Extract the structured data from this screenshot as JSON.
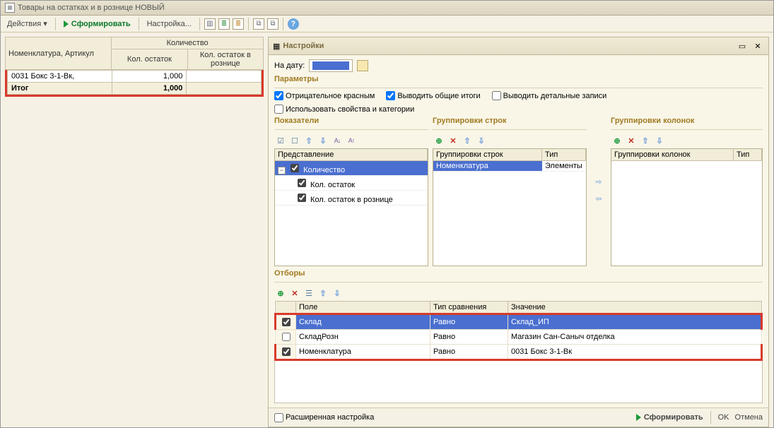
{
  "window": {
    "title": "Товары на остатках и в рознице НОВЫЙ"
  },
  "toolbar": {
    "actions_label": "Действия",
    "run_label": "Сформировать",
    "settings_label": "Настройка..."
  },
  "report": {
    "col_nom": "Номенклатура, Артикул",
    "col_qty": "Количество",
    "col_rest": "Кол. остаток",
    "col_rest_retail": "Кол. остаток в рознице",
    "rows": [
      {
        "nom": "0031 Бокс 3-1-Вк,",
        "rest": "1,000",
        "retail": ""
      }
    ],
    "total_label": "Итог",
    "total_rest": "1,000"
  },
  "settings": {
    "title": "Настройки",
    "date_label": "На дату:",
    "date_value": "  .  .  ",
    "section_params": "Параметры",
    "chk_neg": "Отрицательное красным",
    "chk_grand": "Выводить общие итоги",
    "chk_detail": "Выводить детальные записи",
    "chk_props": "Использовать свойства и категории",
    "section_indicators": "Показатели",
    "ind_col": "Представление",
    "ind_root": "Количество",
    "ind_items": [
      "Кол. остаток",
      "Кол. остаток в рознице"
    ],
    "section_grp_rows": "Группировки строк",
    "grp_col1": "Группировки строк",
    "grp_col2": "Тип",
    "grp_rows": [
      {
        "name": "Номенклатура",
        "type": "Элементы"
      }
    ],
    "section_grp_cols": "Группировки колонок",
    "gcol_col1": "Группировки колонок",
    "gcol_col2": "Тип",
    "section_filters": "Отборы",
    "filt_field": "Поле",
    "filt_cmp": "Тип сравнения",
    "filt_val": "Значение",
    "filters": [
      {
        "on": true,
        "field": "Склад",
        "cmp": "Равно",
        "val": "Склад_ИП",
        "sel": true,
        "red": 1
      },
      {
        "on": false,
        "field": "СкладРозн",
        "cmp": "Равно",
        "val": "Магазин Сан-Саныч отделка",
        "sel": false,
        "red": 0
      },
      {
        "on": true,
        "field": "Номенклатура",
        "cmp": "Равно",
        "val": "0031 Бокс 3-1-Вк",
        "sel": false,
        "red": 2
      }
    ]
  },
  "footer": {
    "advanced": "Расширенная настройка",
    "run": "Сформировать",
    "ok": "OK",
    "cancel": "Отмена"
  }
}
